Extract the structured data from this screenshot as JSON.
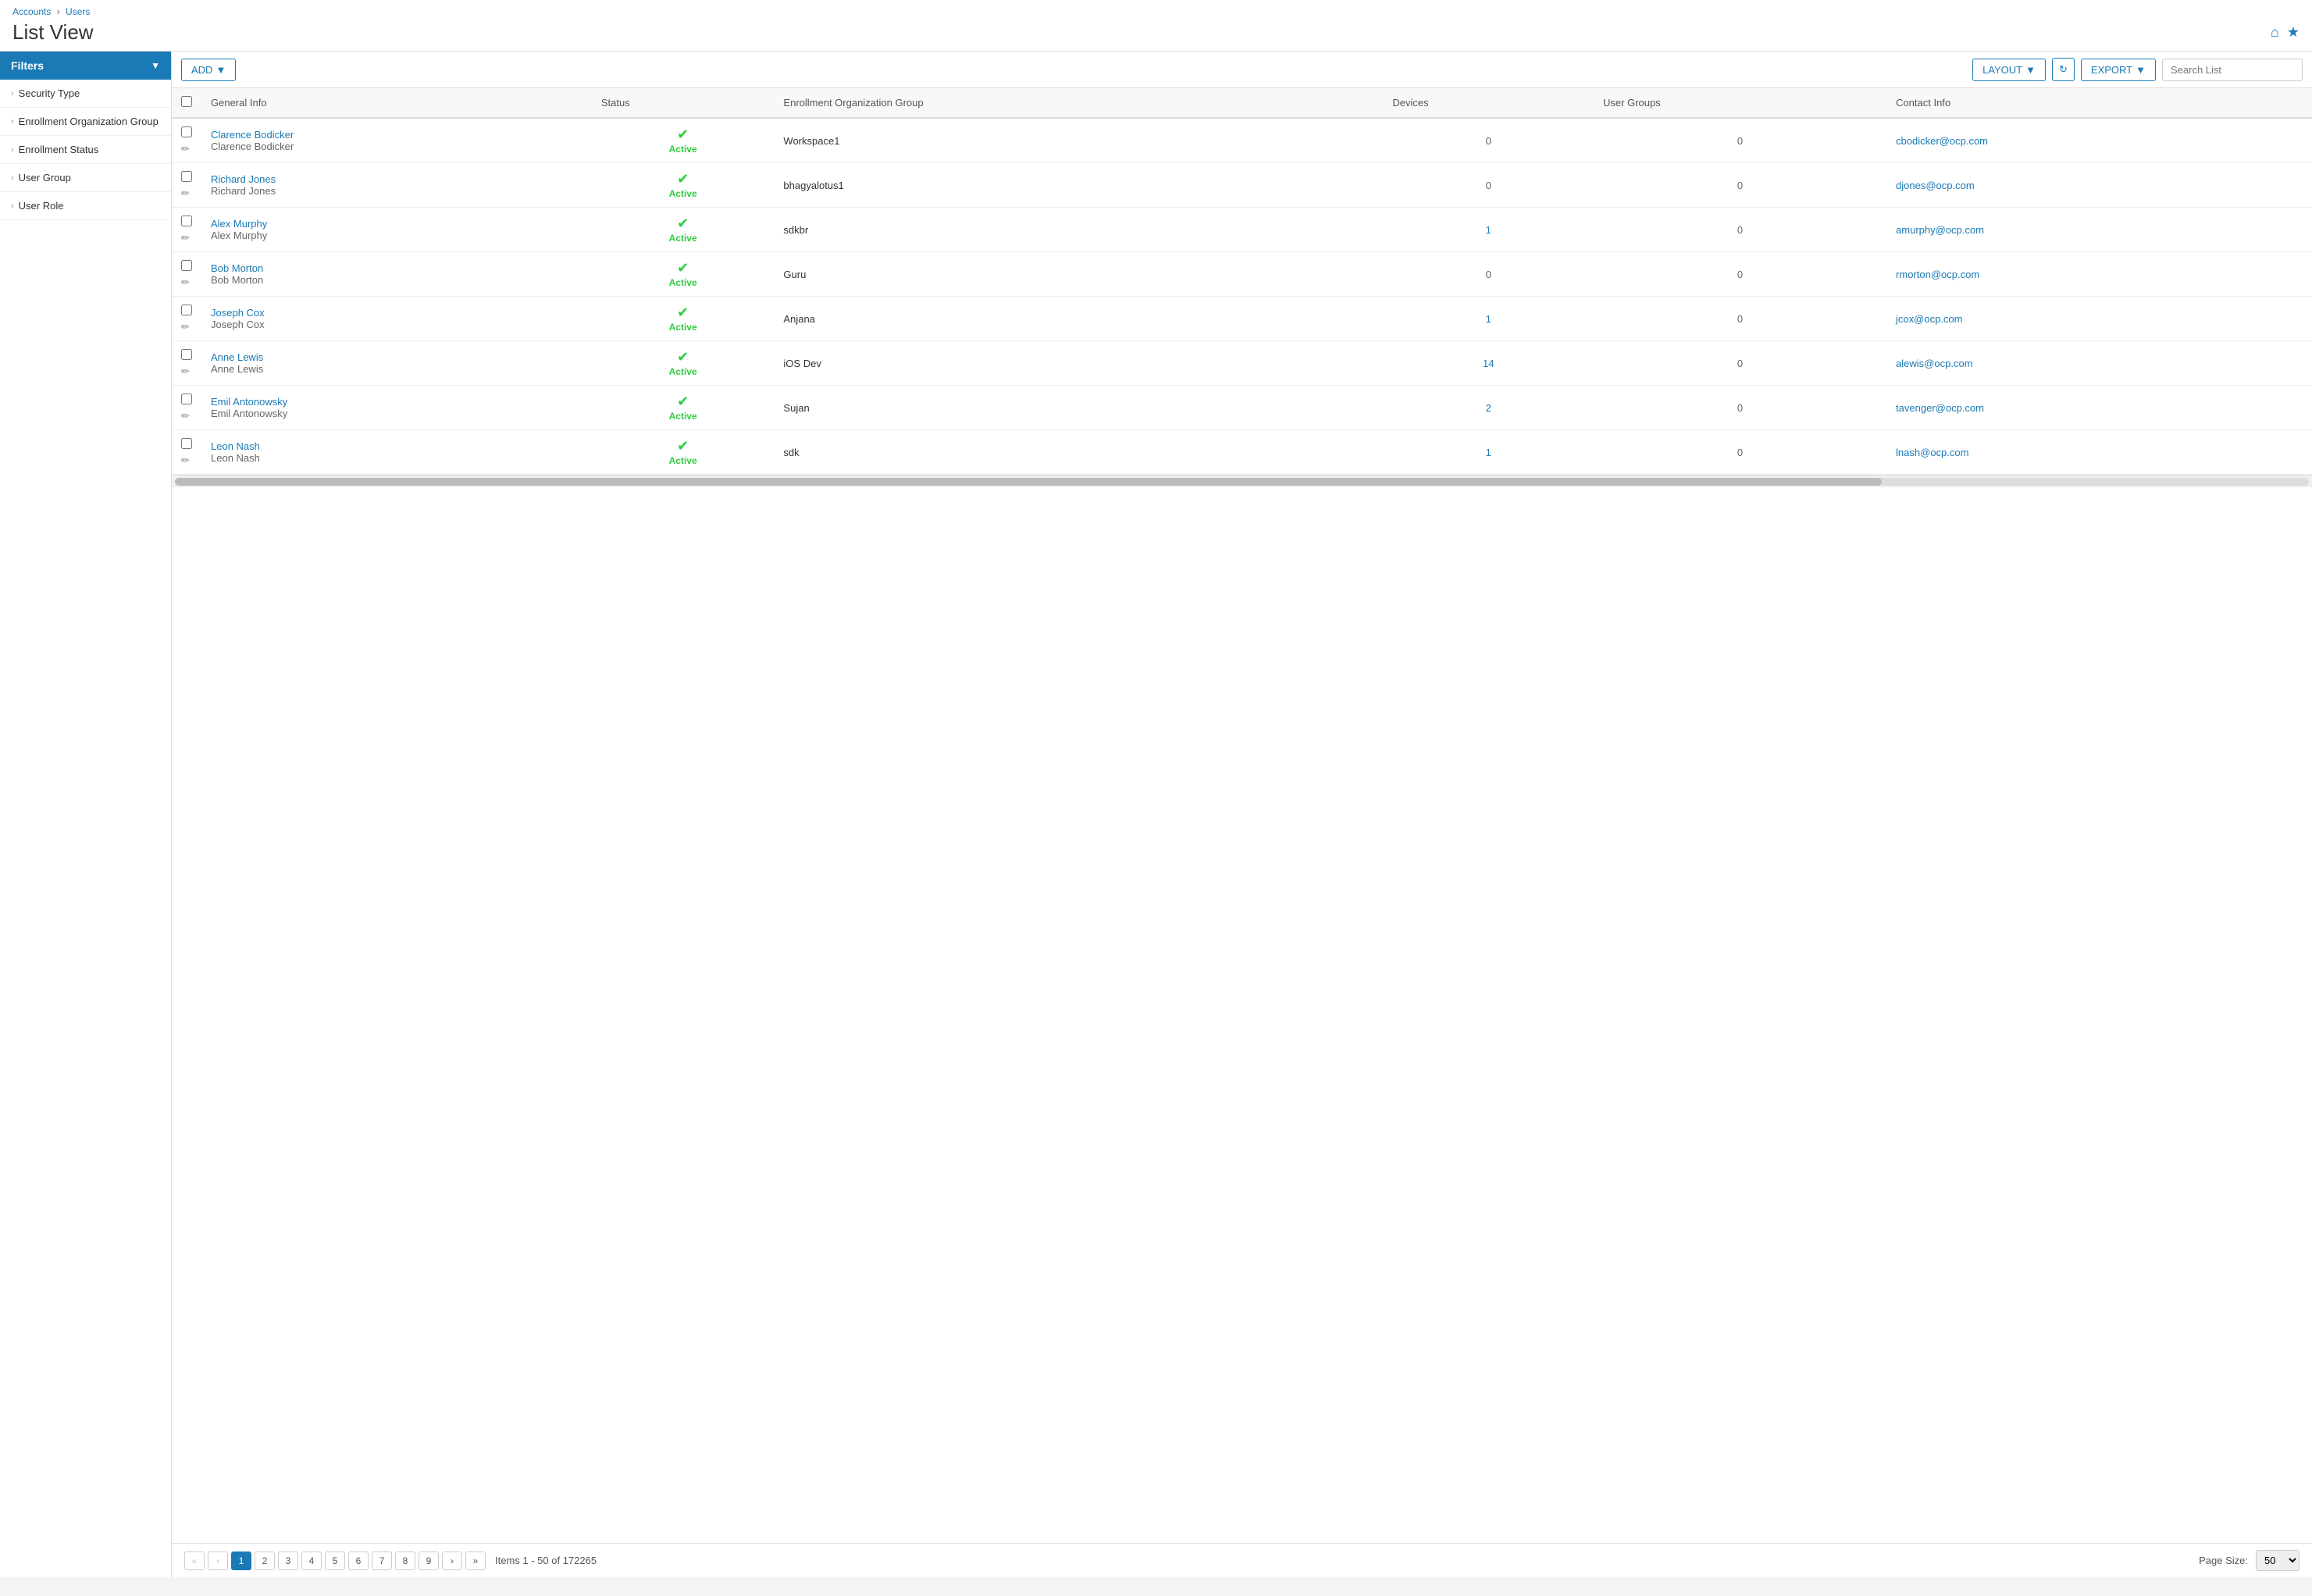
{
  "breadcrumb": {
    "accounts": "Accounts",
    "separator": "›",
    "users": "Users"
  },
  "page": {
    "title": "List View"
  },
  "title_icons": [
    "home-icon",
    "star-icon"
  ],
  "sidebar": {
    "filters_label": "Filters",
    "items": [
      {
        "label": "Security Type",
        "id": "security-type"
      },
      {
        "label": "Enrollment Organization Group",
        "id": "enrollment-org-group"
      },
      {
        "label": "Enrollment Status",
        "id": "enrollment-status"
      },
      {
        "label": "User Group",
        "id": "user-group"
      },
      {
        "label": "User Role",
        "id": "user-role"
      }
    ]
  },
  "toolbar": {
    "add_label": "ADD",
    "layout_label": "LAYOUT",
    "export_label": "EXPORT",
    "search_placeholder": "Search List"
  },
  "table": {
    "columns": [
      {
        "id": "general-info",
        "label": "General Info"
      },
      {
        "id": "status",
        "label": "Status"
      },
      {
        "id": "enrollment-org-group",
        "label": "Enrollment Organization Group"
      },
      {
        "id": "devices",
        "label": "Devices"
      },
      {
        "id": "user-groups",
        "label": "User Groups"
      },
      {
        "id": "contact-info",
        "label": "Contact Info"
      }
    ],
    "rows": [
      {
        "id": 1,
        "name_link": "Clarence Bodicker",
        "name_sub": "Clarence Bodicker",
        "status": "Active",
        "org": "Workspace1",
        "devices": "0",
        "devices_blue": false,
        "user_groups": "0",
        "email": "cbodicker@ocp.com"
      },
      {
        "id": 2,
        "name_link": "Richard Jones",
        "name_sub": "Richard Jones",
        "status": "Active",
        "org": "bhagyalotus1",
        "devices": "0",
        "devices_blue": false,
        "user_groups": "0",
        "email": "djones@ocp.com"
      },
      {
        "id": 3,
        "name_link": "Alex Murphy",
        "name_sub": "Alex Murphy",
        "status": "Active",
        "org": "sdkbr",
        "devices": "1",
        "devices_blue": true,
        "user_groups": "0",
        "email": "amurphy@ocp.com"
      },
      {
        "id": 4,
        "name_link": "Bob Morton",
        "name_sub": "Bob Morton",
        "status": "Active",
        "org": "Guru",
        "devices": "0",
        "devices_blue": false,
        "user_groups": "0",
        "email": "rmorton@ocp.com"
      },
      {
        "id": 5,
        "name_link": "Joseph Cox",
        "name_sub": "Joseph Cox",
        "status": "Active",
        "org": "Anjana",
        "devices": "1",
        "devices_blue": true,
        "user_groups": "0",
        "email": "jcox@ocp.com"
      },
      {
        "id": 6,
        "name_link": "Anne Lewis",
        "name_sub": "Anne Lewis",
        "status": "Active",
        "org": "iOS Dev",
        "devices": "14",
        "devices_blue": true,
        "user_groups": "0",
        "email": "alewis@ocp.com"
      },
      {
        "id": 7,
        "name_link": "Emil Antonowsky",
        "name_sub": "Emil Antonowsky",
        "status": "Active",
        "org": "Sujan",
        "devices": "2",
        "devices_blue": true,
        "user_groups": "0",
        "email": "tavenger@ocp.com"
      },
      {
        "id": 8,
        "name_link": "Leon Nash",
        "name_sub": "Leon Nash",
        "status": "Active",
        "org": "sdk",
        "devices": "1",
        "devices_blue": true,
        "user_groups": "0",
        "email": "lnash@ocp.com"
      }
    ]
  },
  "pagination": {
    "first_label": "«",
    "prev_label": "‹",
    "pages": [
      "1",
      "2",
      "3",
      "4",
      "5",
      "6",
      "7",
      "8",
      "9"
    ],
    "current_page": "1",
    "next_label": "›",
    "last_label": "»",
    "items_info": "Items 1 - 50 of 172265",
    "page_size_label": "Page Size:",
    "page_size_value": "50"
  }
}
